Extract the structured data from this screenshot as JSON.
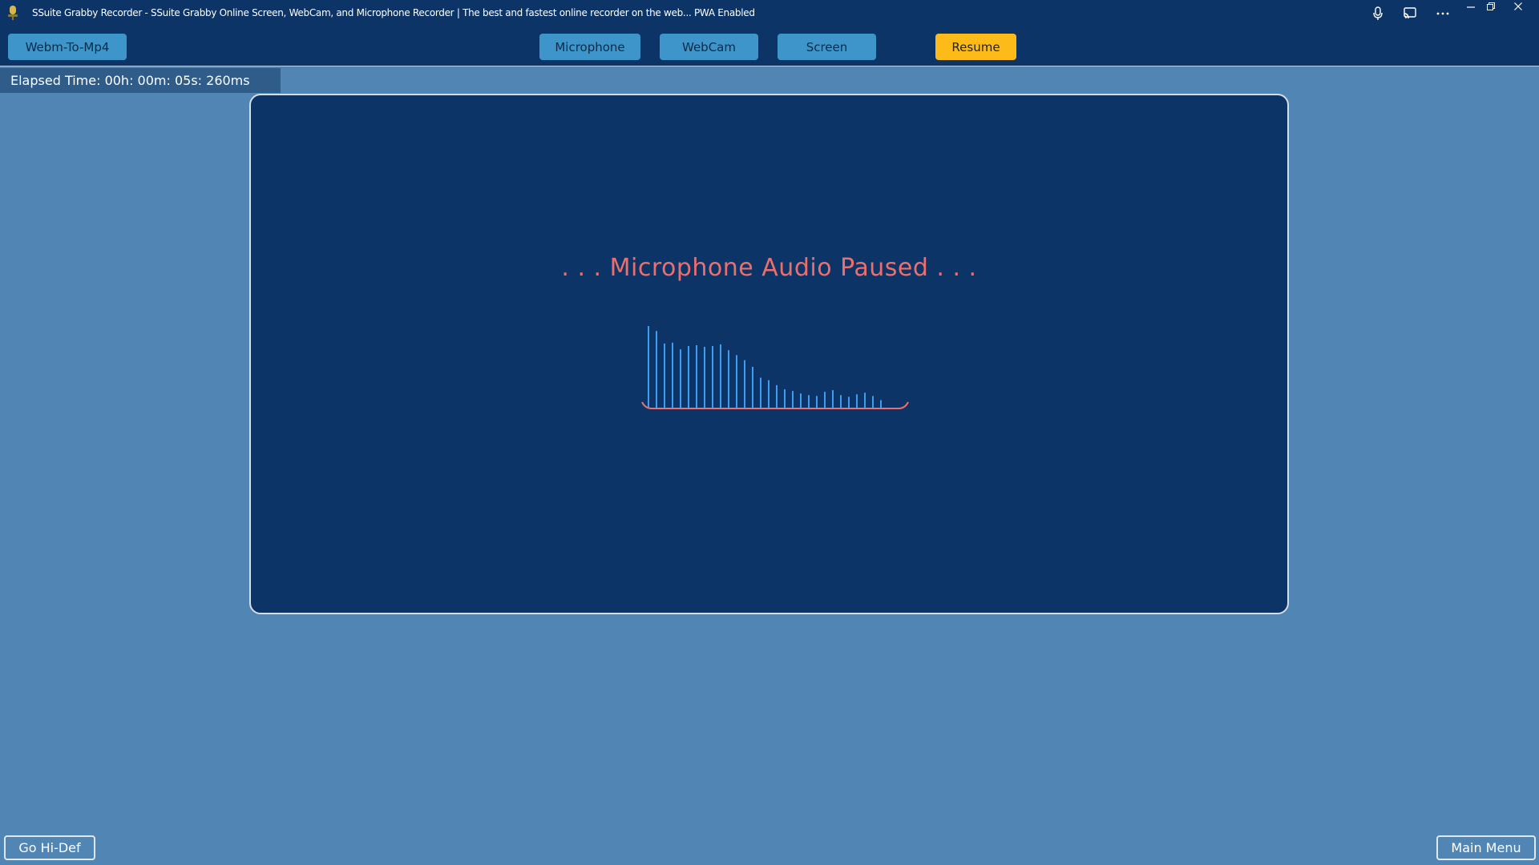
{
  "window": {
    "title": "SSuite Grabby Recorder - SSuite Grabby Online Screen, WebCam, and Microphone Recorder | The best and fastest online recorder on the web... PWA Enabled",
    "icons": {
      "app": "microphone-app-icon",
      "mic": "microphone-icon",
      "cast": "cast-icon",
      "more": "more-options-icon",
      "minimize": "minimize-icon",
      "restore": "restore-icon",
      "close": "close-icon"
    }
  },
  "toolbar": {
    "webm_label": "Webm-To-Mp4",
    "microphone_label": "Microphone",
    "webcam_label": "WebCam",
    "screen_label": "Screen",
    "resume_label": "Resume"
  },
  "elapsed": {
    "text": "Elapsed Time: 00h: 00m: 05s: 260ms"
  },
  "panel": {
    "status_text": ". . . Microphone Audio Paused . . .",
    "visualizer_levels": [
      0.99,
      0.93,
      0.78,
      0.79,
      0.71,
      0.75,
      0.76,
      0.74,
      0.75,
      0.77,
      0.7,
      0.64,
      0.58,
      0.5,
      0.37,
      0.34,
      0.28,
      0.23,
      0.21,
      0.18,
      0.16,
      0.15,
      0.2,
      0.22,
      0.16,
      0.14,
      0.17,
      0.19,
      0.15,
      0.1
    ],
    "colors": {
      "bars": "#3d9df0",
      "baseline": "#ec6f6e"
    }
  },
  "bottom": {
    "hidef_label": "Go Hi-Def",
    "mainmenu_label": "Main Menu"
  }
}
